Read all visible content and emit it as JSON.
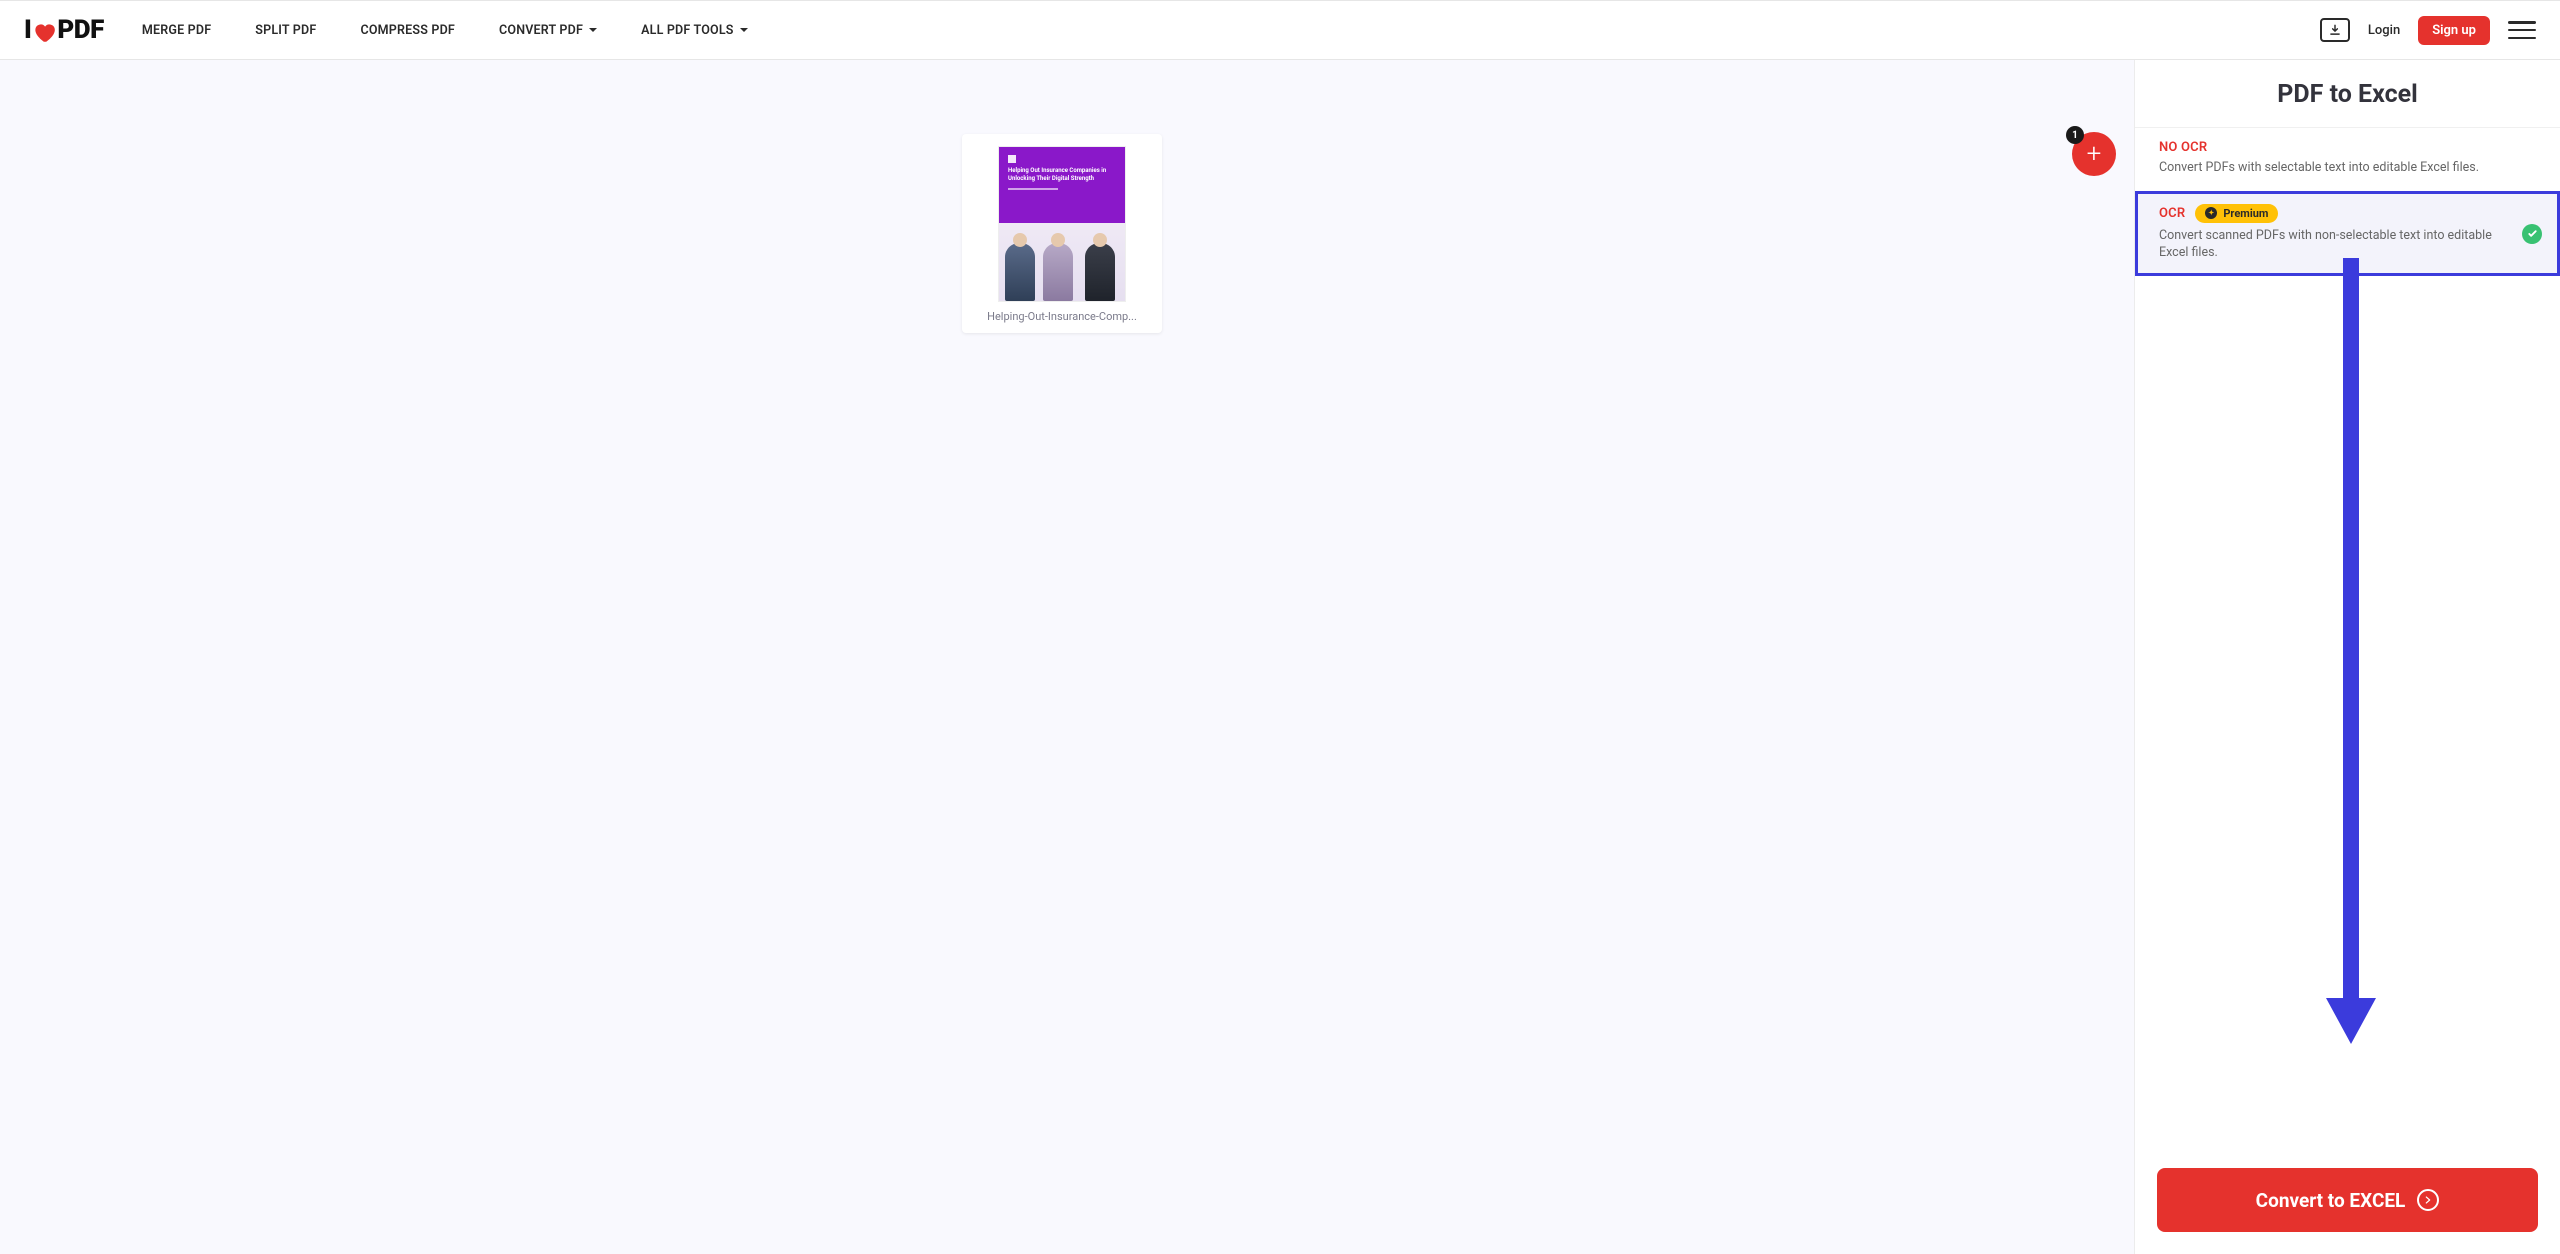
{
  "nav": {
    "logo_text_left": "I",
    "logo_text_right": "PDF",
    "items": [
      {
        "label": "MERGE PDF",
        "dropdown": false
      },
      {
        "label": "SPLIT PDF",
        "dropdown": false
      },
      {
        "label": "COMPRESS PDF",
        "dropdown": false
      },
      {
        "label": "CONVERT PDF",
        "dropdown": true
      },
      {
        "label": "ALL PDF TOOLS",
        "dropdown": true
      }
    ],
    "login_label": "Login",
    "signup_label": "Sign up"
  },
  "canvas": {
    "file": {
      "name": "Helping-Out-Insurance-Comp...",
      "thumb_title": "Helping Out Insurance Companies in Unlocking Their Digital Strength"
    },
    "add_badge_count": "1"
  },
  "sidebar": {
    "title": "PDF to Excel",
    "options": [
      {
        "title": "NO OCR",
        "desc": "Convert PDFs with selectable text into editable Excel files.",
        "premium": false,
        "selected": false
      },
      {
        "title": "OCR",
        "desc": "Convert scanned PDFs with non-selectable text into editable Excel files.",
        "premium": true,
        "premium_label": "Premium",
        "selected": true
      }
    ],
    "convert_label": "Convert to EXCEL"
  },
  "colors": {
    "accent_red": "#e5322d",
    "accent_blue": "#3b3bdc",
    "premium_yellow": "#ffc107",
    "success_green": "#38c172"
  }
}
